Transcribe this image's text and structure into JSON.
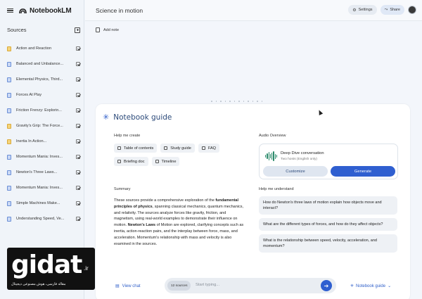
{
  "app": {
    "name": "NotebookLM"
  },
  "sidebar": {
    "title": "Sources",
    "items": [
      {
        "label": "Action and Reaction",
        "icon": "yellow"
      },
      {
        "label": "Balanced and Unbalance...",
        "icon": "blue"
      },
      {
        "label": "Elemental Physics, Third...",
        "icon": "blue"
      },
      {
        "label": "Forces At Play",
        "icon": "blue"
      },
      {
        "label": "Friction Frenzy: Explorin...",
        "icon": "blue"
      },
      {
        "label": "Gravity's Grip: The Force...",
        "icon": "yellow"
      },
      {
        "label": "Inertia In Action...",
        "icon": "yellow"
      },
      {
        "label": "Momentum Mania: Inves...",
        "icon": "blue"
      },
      {
        "label": "Newton's Three Laws...",
        "icon": "blue"
      },
      {
        "label": "Momentum Mania: Inves...",
        "icon": "blue"
      },
      {
        "label": "Simple Machines Make...",
        "icon": "blue"
      },
      {
        "label": "Understanding Speed, Ve...",
        "icon": "blue"
      }
    ]
  },
  "header": {
    "title": "Science in motion",
    "settings": "Settings",
    "share": "Share"
  },
  "main": {
    "add_note": "Add note"
  },
  "guide": {
    "title": "Notebook guide",
    "help_create_label": "Help me create",
    "chips": [
      "Table of contents",
      "Study guide",
      "FAQ",
      "Briefing doc",
      "Timeline"
    ],
    "audio": {
      "label": "Audio Overview",
      "title": "Deep Dive conversation",
      "subtitle": "Two hosts (English only)",
      "customize": "Customize",
      "generate": "Generate"
    },
    "summary_label": "Summary",
    "summary": {
      "p1": "These sources provide a comprehensive exploration of the ",
      "b1": "fundamental principles of physics",
      "p2": ", spanning classical mechanics, quantum mechanics, and relativity. The sources analyze forces like gravity, friction, and magnetism, using real-world examples to demonstrate their influence on motion. ",
      "b2": "Newton's Laws",
      "p3": " of Motion are explored, clarifying concepts such as inertia, action-reaction pairs, and the interplay between force, mass, and acceleration. Momentum's relationship with mass and velocity is also examined in the sources."
    },
    "understand_label": "Help me understand",
    "questions": [
      "How do Newton's three laws of motion explain how objects move and interact?",
      "What are the different types of forces, and how do they affect objects?",
      "What is the relationship between speed, velocity, acceleration, and momentum?"
    ]
  },
  "chat": {
    "view_chat": "View chat",
    "sources_count": "12 sources",
    "placeholder": "Start typing...",
    "guide_button": "Notebook guide"
  },
  "watermark": {
    "text": "gidat",
    "domain": ".ir",
    "tagline": "مقاله فارسی، هوش مصنوعی دیجیتال"
  },
  "colors": {
    "accent": "#2f5fd0",
    "bg": "#f3f6fb"
  }
}
